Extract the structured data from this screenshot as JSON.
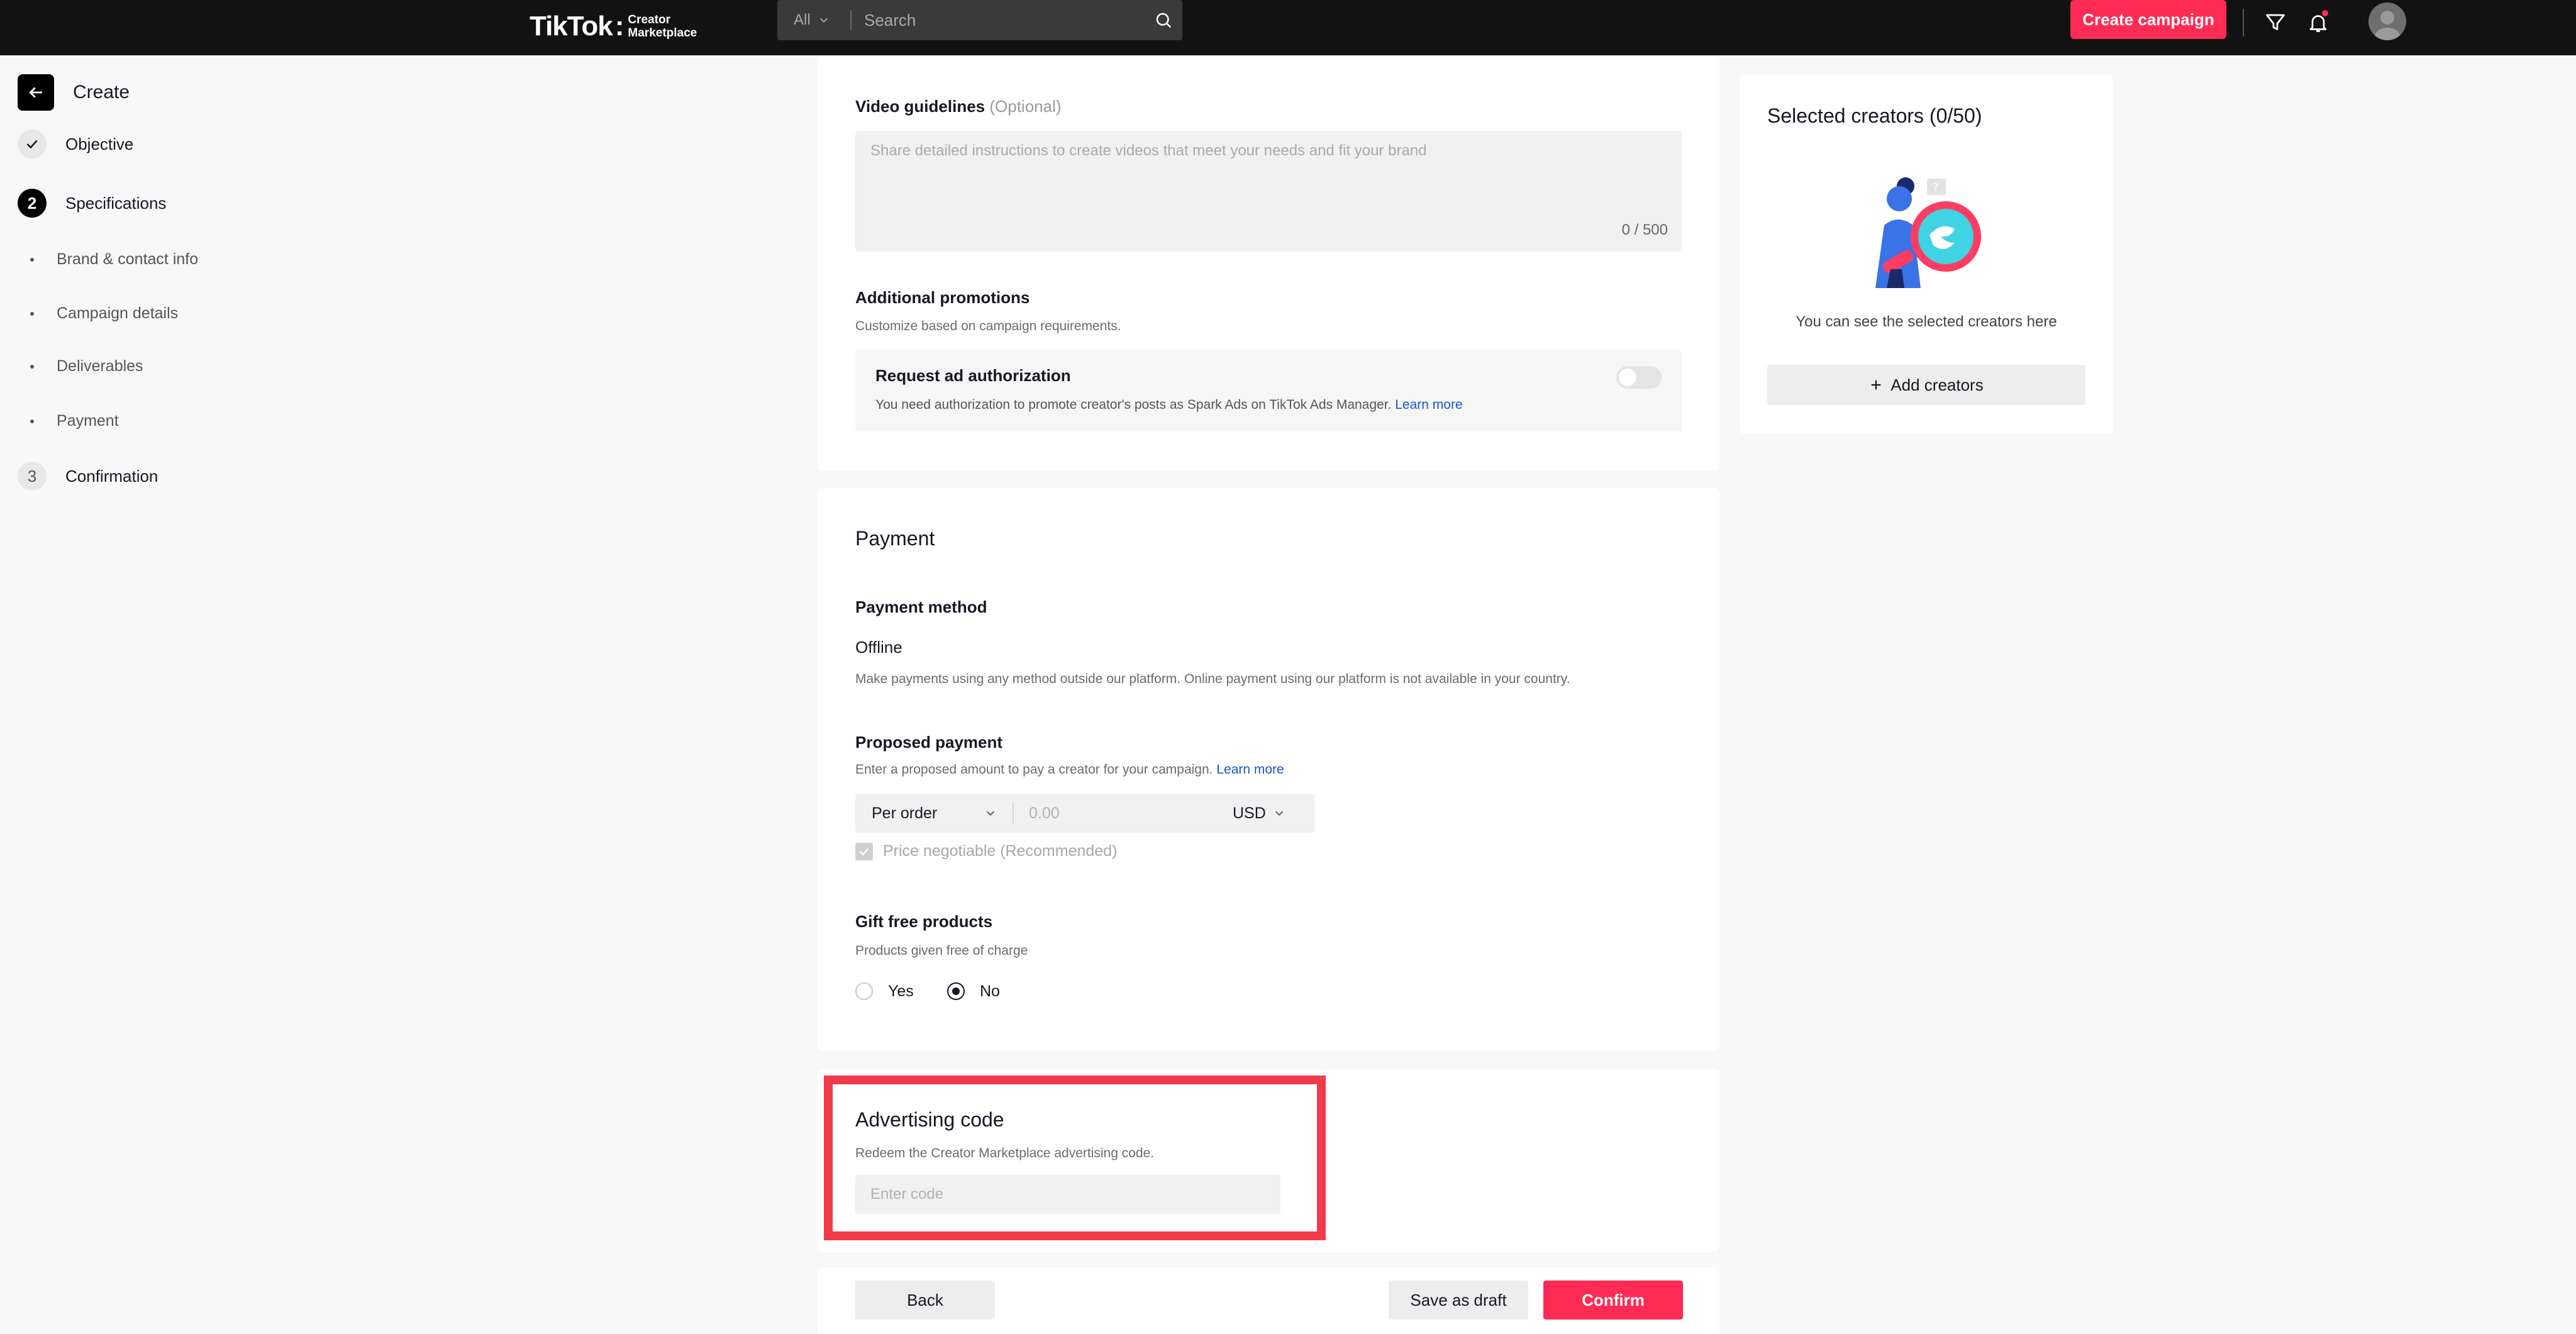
{
  "topbar": {
    "logo_word": "TikTok",
    "logo_line1": "Creator",
    "logo_line2": "Marketplace",
    "search_scope": "All",
    "search_placeholder": "Search",
    "create_campaign_label": "Create campaign",
    "icons": [
      "filter-icon",
      "bell-icon",
      "avatar"
    ],
    "accent_color": "#fe2c55"
  },
  "sidebar": {
    "title": "Create",
    "steps": [
      {
        "marker": "check",
        "label": "Objective",
        "state": "done"
      },
      {
        "marker": "2",
        "label": "Specifications",
        "state": "active"
      },
      {
        "marker": "3",
        "label": "Confirmation",
        "state": "todo"
      }
    ],
    "substeps": [
      "Brand & contact info",
      "Campaign details",
      "Deliverables",
      "Payment"
    ]
  },
  "video_guidelines": {
    "label": "Video guidelines",
    "optional": "(Optional)",
    "placeholder": "Share detailed instructions to create videos that meet your needs and fit your brand",
    "counter": "0 / 500"
  },
  "additional_promotions": {
    "label": "Additional promotions",
    "description": "Customize based on campaign requirements.",
    "ad_auth_title": "Request ad authorization",
    "ad_auth_desc": "You need authorization to promote creator's posts as Spark Ads on TikTok Ads Manager.",
    "learn_more": "Learn more",
    "toggle_on": false
  },
  "payment": {
    "title": "Payment",
    "method_label": "Payment method",
    "method_value": "Offline",
    "method_desc": "Make payments using any method outside our platform. Online payment using our platform is not available in your country.",
    "proposed_label": "Proposed payment",
    "proposed_desc": "Enter a proposed amount to pay a creator for your campaign.",
    "learn_more": "Learn more",
    "payment_type": "Per order",
    "amount_placeholder": "0.00",
    "currency": "USD",
    "negotiable_label": "Price negotiable (Recommended)",
    "negotiable_checked": true,
    "gift_label": "Gift free products",
    "gift_desc": "Products given free of charge",
    "gift_yes": "Yes",
    "gift_no": "No",
    "gift_selected": "No"
  },
  "advertising_code": {
    "title": "Advertising code",
    "description": "Redeem the Creator Marketplace advertising code.",
    "placeholder": "Enter code"
  },
  "footer": {
    "back": "Back",
    "save_draft": "Save as draft",
    "confirm": "Confirm"
  },
  "selected_creators": {
    "title": "Selected creators (0/50)",
    "empty_text": "You can see the selected creators here",
    "add_label": "Add creators"
  }
}
